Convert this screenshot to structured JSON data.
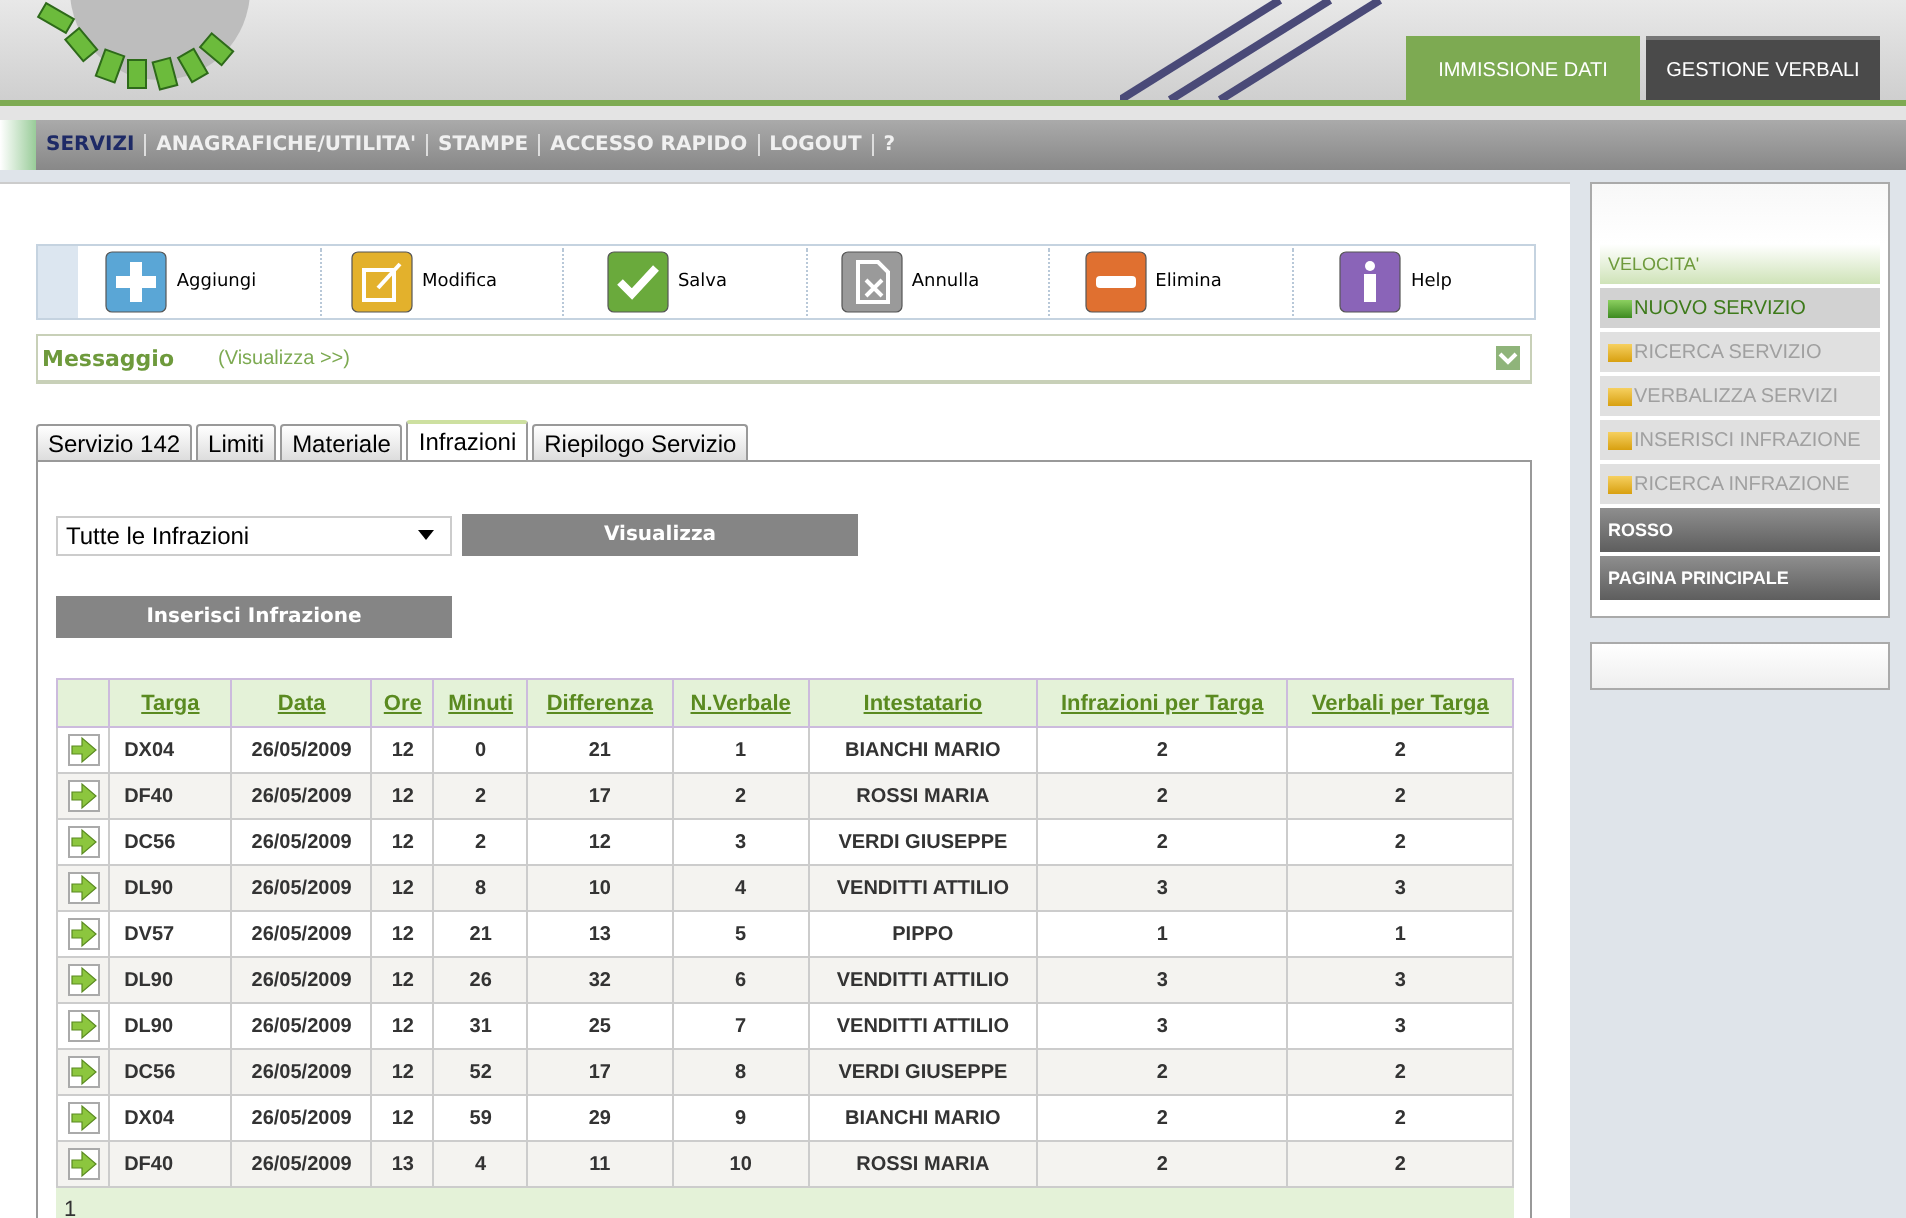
{
  "header_tabs": [
    {
      "label": "IMMISSIONE DATI",
      "selected": true
    },
    {
      "label": "GESTIONE VERBALI",
      "selected": false
    }
  ],
  "nav": [
    {
      "label": "SERVIZI",
      "selected": true
    },
    {
      "label": "ANAGRAFICHE/UTILITA'",
      "selected": false
    },
    {
      "label": "STAMPE",
      "selected": false
    },
    {
      "label": "ACCESSO RAPIDO",
      "selected": false
    },
    {
      "label": "LOGOUT",
      "selected": false
    },
    {
      "label": "?",
      "selected": false
    }
  ],
  "toolbar": [
    {
      "kind": "add",
      "label": "Aggiungi"
    },
    {
      "kind": "edit",
      "label": "Modifica"
    },
    {
      "kind": "save",
      "label": "Salva"
    },
    {
      "kind": "cancel",
      "label": "Annulla"
    },
    {
      "kind": "delete",
      "label": "Elimina"
    },
    {
      "kind": "help",
      "label": "Help"
    }
  ],
  "message": {
    "title": "Messaggio",
    "link": "(Visualizza >>)"
  },
  "tabs": [
    {
      "label": "Servizio 142",
      "selected": false
    },
    {
      "label": "Limiti",
      "selected": false
    },
    {
      "label": "Materiale",
      "selected": false
    },
    {
      "label": "Infrazioni",
      "selected": true
    },
    {
      "label": "Riepilogo Servizio",
      "selected": false
    }
  ],
  "filter": {
    "value": "Tutte le Infrazioni",
    "button": "Visualizza"
  },
  "insert_button": "Inserisci Infrazione",
  "table": {
    "columns": [
      "Targa",
      "Data",
      "Ore",
      "Minuti",
      "Differenza",
      "N.Verbale",
      "Intestatario",
      "Infrazioni per Targa",
      "Verbali per Targa"
    ],
    "rows": [
      [
        "DX04",
        "26/05/2009",
        "12",
        "0",
        "21",
        "1",
        "BIANCHI MARIO",
        "2",
        "2"
      ],
      [
        "DF40",
        "26/05/2009",
        "12",
        "2",
        "17",
        "2",
        "ROSSI MARIA",
        "2",
        "2"
      ],
      [
        "DC56",
        "26/05/2009",
        "12",
        "2",
        "12",
        "3",
        "VERDI GIUSEPPE",
        "2",
        "2"
      ],
      [
        "DL90",
        "26/05/2009",
        "12",
        "8",
        "10",
        "4",
        "VENDITTI ATTILIO",
        "3",
        "3"
      ],
      [
        "DV57",
        "26/05/2009",
        "12",
        "21",
        "13",
        "5",
        "PIPPO",
        "1",
        "1"
      ],
      [
        "DL90",
        "26/05/2009",
        "12",
        "26",
        "32",
        "6",
        "VENDITTI ATTILIO",
        "3",
        "3"
      ],
      [
        "DL90",
        "26/05/2009",
        "12",
        "31",
        "25",
        "7",
        "VENDITTI ATTILIO",
        "3",
        "3"
      ],
      [
        "DC56",
        "26/05/2009",
        "12",
        "52",
        "17",
        "8",
        "VERDI GIUSEPPE",
        "2",
        "2"
      ],
      [
        "DX04",
        "26/05/2009",
        "12",
        "59",
        "29",
        "9",
        "BIANCHI MARIO",
        "2",
        "2"
      ],
      [
        "DF40",
        "26/05/2009",
        "13",
        "4",
        "11",
        "10",
        "ROSSI MARIA",
        "2",
        "2"
      ]
    ],
    "pager": "1"
  },
  "sidebar": [
    {
      "kind": "group",
      "label": "VELOCITA'"
    },
    {
      "kind": "item",
      "label": "NUOVO SERVIZIO",
      "selected": true
    },
    {
      "kind": "item",
      "label": "RICERCA SERVIZIO",
      "selected": false
    },
    {
      "kind": "item",
      "label": "VERBALIZZA SERVIZI",
      "selected": false
    },
    {
      "kind": "item",
      "label": "INSERISCI INFRAZIONE",
      "selected": false
    },
    {
      "kind": "item",
      "label": "RICERCA INFRAZIONE",
      "selected": false
    },
    {
      "kind": "link",
      "label": "ROSSO"
    },
    {
      "kind": "link",
      "label": "PAGINA PRINCIPALE"
    }
  ]
}
